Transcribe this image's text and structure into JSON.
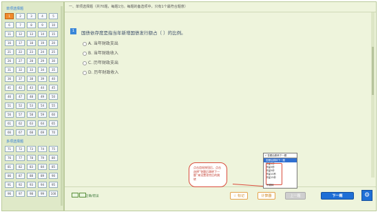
{
  "sidebar": {
    "section1_title": "单项选择题",
    "section1_cells": [
      "1",
      "2",
      "3",
      "4",
      "5",
      "6",
      "7",
      "8",
      "9",
      "10",
      "11",
      "12",
      "13",
      "14",
      "15",
      "16",
      "17",
      "18",
      "19",
      "20",
      "21",
      "22",
      "23",
      "24",
      "25",
      "26",
      "27",
      "28",
      "29",
      "30",
      "31",
      "32",
      "33",
      "34",
      "35",
      "36",
      "37",
      "38",
      "39",
      "40",
      "41",
      "42",
      "43",
      "44",
      "45",
      "46",
      "47",
      "48",
      "49",
      "50",
      "51",
      "52",
      "53",
      "54",
      "55",
      "56",
      "57",
      "58",
      "59",
      "60",
      "61",
      "62",
      "63",
      "64",
      "65",
      "66",
      "67",
      "68",
      "69",
      "70"
    ],
    "section2_title": "多项选择题",
    "section2_cells": [
      "71",
      "72",
      "73",
      "74",
      "75",
      "76",
      "77",
      "78",
      "79",
      "80",
      "81",
      "82",
      "83",
      "84",
      "85",
      "86",
      "87",
      "88",
      "89",
      "90",
      "91",
      "92",
      "93",
      "94",
      "95",
      "96",
      "97",
      "98",
      "99",
      "100"
    ]
  },
  "header": {
    "text": "一、单项选择题（共70题，每题1分。每题的备选项中，只有1个最符合题意）"
  },
  "question": {
    "number": "1",
    "text": "国债依存度是指当年新增国债发行额占（    ）的比例。",
    "options": [
      "A. 当年财政支出",
      "B. 当年财政收入",
      "C. 历年财政支出",
      "D. 历年财政收入"
    ]
  },
  "bottom": {
    "mark_label": "正确/错误",
    "mark_button": "☆ 标记",
    "calc_button": "计算器",
    "prev_button": "上一题",
    "next_button": "下一题",
    "gear_icon": "⚙"
  },
  "tooltip": {
    "text": "点击齿轮按钮后，点击选择“答题后跳转下一题”来设置答完后的跳转"
  },
  "dropdown": {
    "top": "√ 答题后跳转下一题",
    "selected": "答题后跳转下一题",
    "items": [
      "停留1秒",
      "停留3秒",
      "停留5秒",
      "停留10秒",
      "停留15秒"
    ],
    "last": "不跳转"
  }
}
